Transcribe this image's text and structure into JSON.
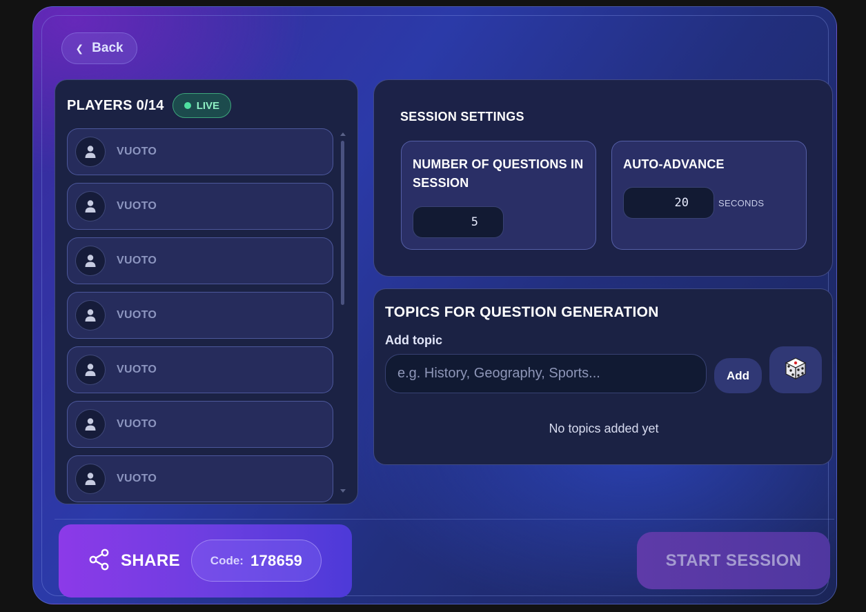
{
  "nav": {
    "back_label": "Back"
  },
  "players": {
    "title": "PLAYERS 0/14",
    "live_label": "LIVE",
    "slots": [
      {
        "name": "VUOTO"
      },
      {
        "name": "VUOTO"
      },
      {
        "name": "VUOTO"
      },
      {
        "name": "VUOTO"
      },
      {
        "name": "VUOTO"
      },
      {
        "name": "VUOTO"
      },
      {
        "name": "VUOTO"
      }
    ]
  },
  "settings": {
    "title": "SESSION SETTINGS",
    "questions": {
      "label": "NUMBER OF QUESTIONS IN SESSION",
      "value": "5"
    },
    "auto_advance": {
      "label": "AUTO-ADVANCE",
      "value": "20",
      "unit": "SECONDS"
    }
  },
  "topics": {
    "title": "TOPICS FOR QUESTION GENERATION",
    "add_label": "Add topic",
    "placeholder": "e.g. History, Geography, Sports...",
    "add_button": "Add",
    "empty_text": "No topics added yet"
  },
  "footer": {
    "share_label": "SHARE",
    "code_label": "Code:",
    "code_value": "178659",
    "start_label": "START SESSION"
  },
  "colors": {
    "live_accent": "#4fe0a0",
    "share_gradient_start": "#8c3ae8",
    "share_gradient_end": "#4d3ad8",
    "start_button": "#5e3aa8"
  },
  "icons": {
    "back": "chevron-left-icon",
    "player_avatar": "user-icon",
    "random_topic": "dice-icon",
    "share": "share-icon"
  }
}
